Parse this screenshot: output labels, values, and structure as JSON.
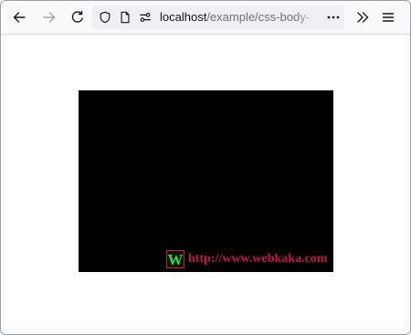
{
  "toolbar": {
    "back_icon": "arrow-left-icon",
    "forward_icon": "arrow-right-icon",
    "reload_icon": "reload-icon",
    "url_host": "localhost",
    "url_path": "/example/css-body-",
    "page_actions_icon": "more-horizontal-icon",
    "overflow_icon": "chevrons-right-icon",
    "menu_icon": "hamburger-menu-icon"
  },
  "page": {
    "watermark_logo_letter": "W",
    "watermark_url": "http://www.webkaka.com"
  },
  "colors": {
    "box": "#000000",
    "watermark_text": "#c8124a",
    "watermark_logo": "#22e23a"
  }
}
